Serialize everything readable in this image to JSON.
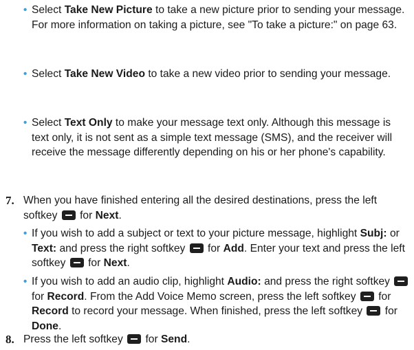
{
  "bullets_top": [
    {
      "pre": "Select ",
      "bold": "Take New Picture",
      "post": " to take a new picture prior to sending your message. For more information on taking a picture, see \"To take a picture:\" on page 63."
    },
    {
      "pre": "Select ",
      "bold": "Take New Video",
      "post": " to take a new video prior to sending your message."
    },
    {
      "pre": "Select ",
      "bold": "Text Only",
      "post": " to make your message text only. Although this message is text only, it is not sent as a simple text message (SMS), and the receiver will receive the message differently depending on his or her phone's capability."
    }
  ],
  "step7": {
    "number": "7.",
    "text_a": "When you have finished entering all the desired destinations, press the left softkey",
    "text_b": "for",
    "bold_a": "Next",
    "text_c": "."
  },
  "step7_bullets": {
    "b1": {
      "t1": "If you wish to add a subject or text to your picture message, highlight",
      "b1": "Subj:",
      "t2": "or",
      "b2": "Text:",
      "t3": "and press the right softkey",
      "t4": "for",
      "b3": "Add",
      "t5": ". Enter your text and press the left softkey",
      "t6": "for",
      "b4": "Next",
      "t7": "."
    },
    "b2": {
      "t1": "If you wish to add an audio clip, highlight",
      "b1": "Audio:",
      "t2": "and press the right softkey",
      "t3": "for",
      "b2": "Record",
      "t4": ". From the Add Voice Memo screen, press the left softkey",
      "t5": "for",
      "b3": "Record",
      "t6": "to record your message. When finished, press the left softkey",
      "t7": "for",
      "b4": "Done",
      "t8": "."
    }
  },
  "step8": {
    "number": "8.",
    "text_a": "Press the left softkey",
    "text_b": "for",
    "bold_a": "Send",
    "text_c": "."
  },
  "colors": {
    "bullet": "#3aa0de",
    "softkey": "#1f1f1f",
    "text": "#1a1a1a"
  },
  "icons": {
    "softkey": "softkey-icon"
  }
}
